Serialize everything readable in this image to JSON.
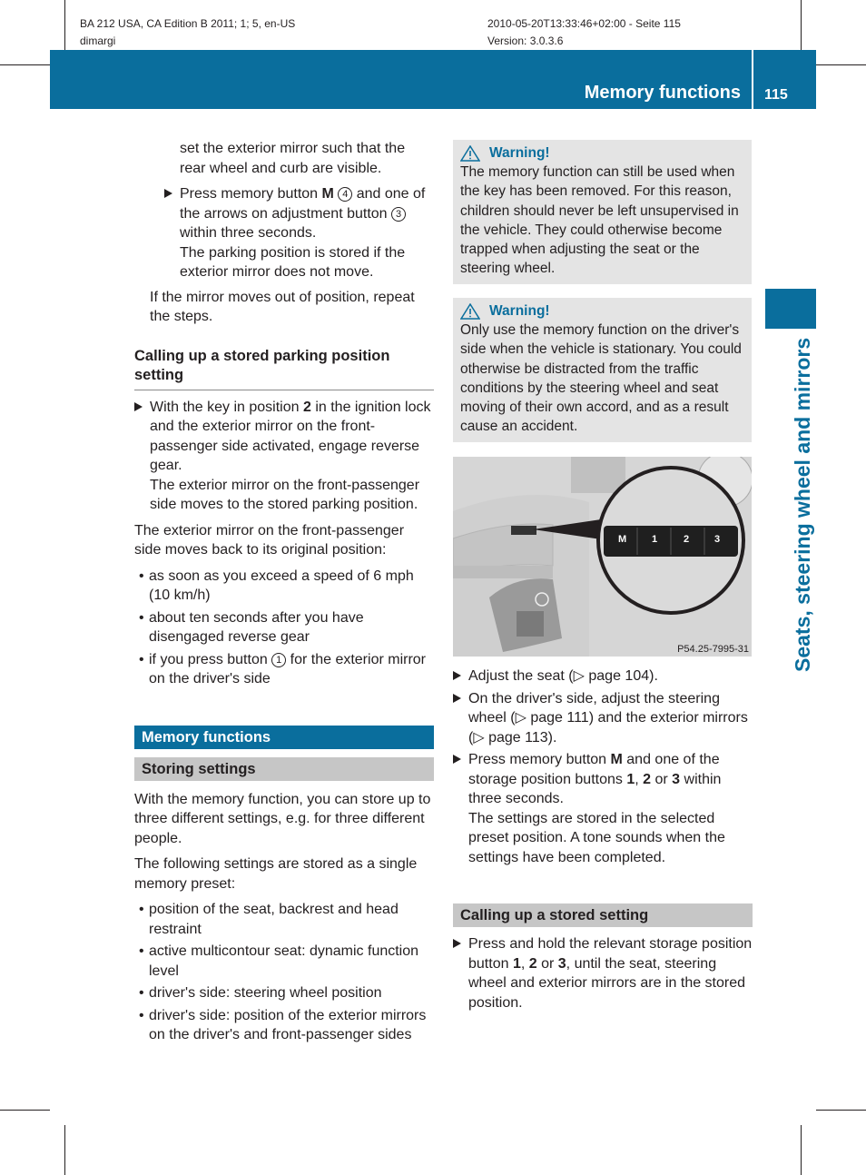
{
  "meta": {
    "doc_id": "BA 212 USA, CA Edition B 2011; 1; 5, en-US",
    "author": "dimargi",
    "timestamp": "2010-05-20T13:33:46+02:00 - Seite 115",
    "version": "Version: 3.0.3.6"
  },
  "header": {
    "title": "Memory functions",
    "page_number": "115",
    "color": "#0a6e9d"
  },
  "side_tab": {
    "label": "Seats, steering wheel and mirrors"
  },
  "left": {
    "intro_cont": "set the exterior mirror such that the rear wheel and curb are visible.",
    "step1": {
      "a": "Press memory button ",
      "b": "M",
      "c": "4",
      "d": " and one of the arrows on adjustment button ",
      "e": "3",
      "f": " within three seconds.",
      "result": "The parking position is stored if the exterior mirror does not move."
    },
    "repeat": "If the mirror moves out of position, repeat the steps.",
    "h_calling_parking": "Calling up a stored parking position setting",
    "step2": {
      "a": "With the key in position ",
      "b": "2",
      "c": " in the ignition lock and the exterior mirror on the front-passenger side activated, engage reverse gear.",
      "result": "The exterior mirror on the front-passenger side moves to the stored parking position."
    },
    "moves_back": "The exterior mirror on the front-passenger side moves back to its original position:",
    "bullets1": [
      "as soon as you exceed a speed of 6 mph (10 km/h)",
      "about ten seconds after you have disengaged reverse gear"
    ],
    "bullet3": {
      "a": "if you press button ",
      "b": "1",
      "c": " for the exterior mirror on the driver's side"
    },
    "sec_memory": "Memory functions",
    "sec_storing": "Storing settings",
    "storing_p1": "With the memory function, you can store up to three different settings, e.g. for three different people.",
    "storing_p2": "The following settings are stored as a single memory preset:",
    "bullets2": [
      "position of the seat, backrest and head restraint",
      "active multicontour seat: dynamic function level",
      "driver's side: steering wheel position",
      "driver's side: position of the exterior mirrors on the driver's and front-passenger sides"
    ]
  },
  "right": {
    "warning_label": "Warning!",
    "warning1": "The memory function can still be used when the key has been removed. For this reason, children should never be left unsupervised in the vehicle. They could otherwise become trapped when adjusting the seat or the steering wheel.",
    "warning2": "Only use the memory function on the driver's side when the vehicle is stationary. You could otherwise be distracted from the traffic conditions by the steering wheel and seat moving of their own accord, and as a result cause an accident.",
    "figure": {
      "buttons": [
        "M",
        "1",
        "2",
        "3"
      ],
      "caption": "P54.25-7995-31"
    },
    "s1": {
      "a": "Adjust the seat (",
      "ref": "▷ page 104",
      "b": ")."
    },
    "s2": {
      "a": "On the driver's side, adjust the steering wheel (",
      "ref1": "▷ page 111",
      "b": ") and the exterior mirrors (",
      "ref2": "▷ page 113",
      "c": ")."
    },
    "s3": {
      "a": "Press memory button ",
      "m": "M",
      "b": " and one of the storage position buttons ",
      "n1": "1",
      "c": ", ",
      "n2": "2",
      "d": " or ",
      "n3": "3",
      "e": " within three seconds.",
      "result": "The settings are stored in the selected preset position. A tone sounds when the settings have been completed."
    },
    "sec_calling": "Calling up a stored setting",
    "s4": {
      "a": "Press and hold the relevant storage position button ",
      "n1": "1",
      "b": ", ",
      "n2": "2",
      "c": " or ",
      "n3": "3",
      "d": ", until the seat, steering wheel and exterior mirrors are in the stored position."
    }
  }
}
